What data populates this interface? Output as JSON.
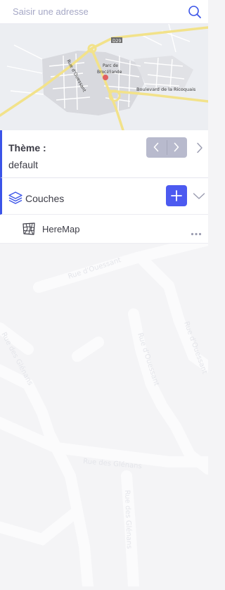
{
  "search": {
    "placeholder": "Saisir une adresse"
  },
  "map_thumbnail": {
    "labels": [
      "D29",
      "Parc de",
      "Brocéliande",
      "Rue d'Ouessant",
      "Boulevard de la Ricoquais"
    ]
  },
  "theme": {
    "label": "Thème :",
    "value": "default"
  },
  "layers": {
    "label": "Couches",
    "items": [
      {
        "name": "HereMap"
      }
    ]
  },
  "background_map": {
    "street_labels": [
      "Rue d'Ouessant",
      "Rue d'Ouessant",
      "Rue d'Ouessant",
      "Rue des Glénans",
      "Rue des Glénans",
      "Rue des Glénans"
    ]
  },
  "colors": {
    "accent": "#4c5af0",
    "section_border": "#3b54e8",
    "nav_button_bg": "#b8bacd",
    "placeholder": "#a6a8c6"
  },
  "icons": {
    "search": "search-icon",
    "prev": "chevron-left-icon",
    "next": "chevron-right-icon",
    "expand_theme": "chevron-right-icon",
    "layers": "layers-icon",
    "add": "plus-icon",
    "collapse": "chevron-down-icon",
    "layer_type": "map-grid-icon",
    "layer_menu": "more-horizontal-icon"
  }
}
